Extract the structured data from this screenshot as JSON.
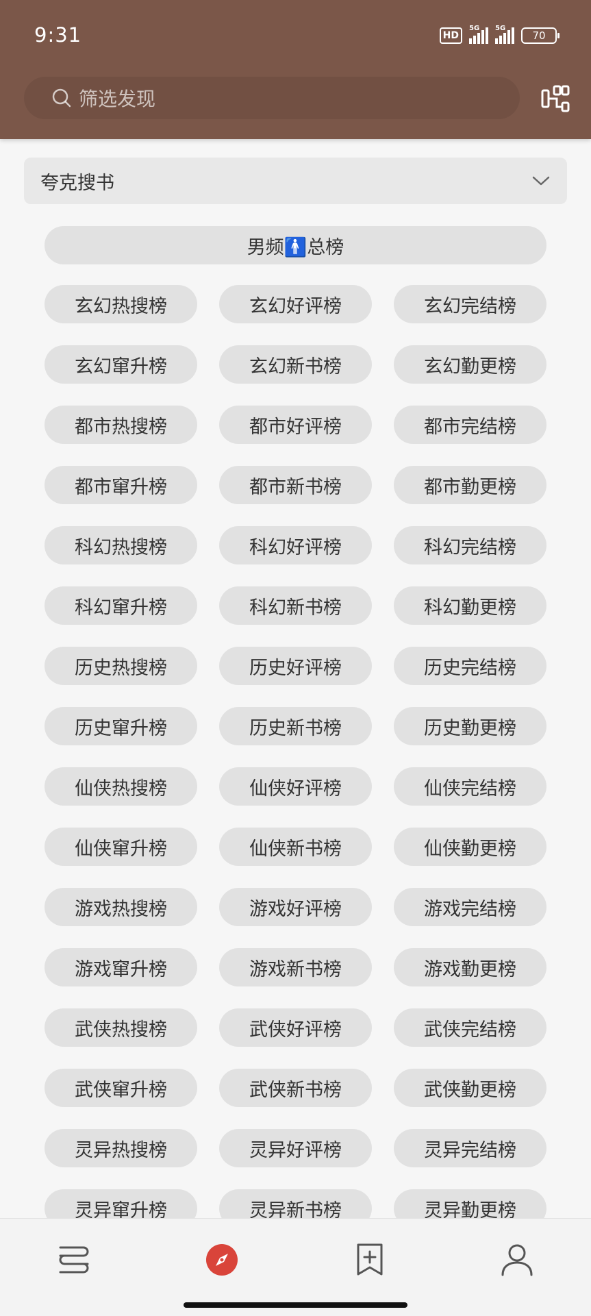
{
  "status_bar": {
    "time": "9:31",
    "hd_label": "HD",
    "sim1_label": "5G",
    "sim2_label": "5G",
    "battery": "70"
  },
  "header": {
    "search_placeholder": "筛选发现",
    "search_icon": "search-icon",
    "scan_icon": "scan-icon"
  },
  "source_selector": {
    "value": "夸克搜书"
  },
  "total_ranking": "男频🚹总榜",
  "rankings": [
    "玄幻热搜榜",
    "玄幻好评榜",
    "玄幻完结榜",
    "玄幻窜升榜",
    "玄幻新书榜",
    "玄幻勤更榜",
    "都市热搜榜",
    "都市好评榜",
    "都市完结榜",
    "都市窜升榜",
    "都市新书榜",
    "都市勤更榜",
    "科幻热搜榜",
    "科幻好评榜",
    "科幻完结榜",
    "科幻窜升榜",
    "科幻新书榜",
    "科幻勤更榜",
    "历史热搜榜",
    "历史好评榜",
    "历史完结榜",
    "历史窜升榜",
    "历史新书榜",
    "历史勤更榜",
    "仙侠热搜榜",
    "仙侠好评榜",
    "仙侠完结榜",
    "仙侠窜升榜",
    "仙侠新书榜",
    "仙侠勤更榜",
    "游戏热搜榜",
    "游戏好评榜",
    "游戏完结榜",
    "游戏窜升榜",
    "游戏新书榜",
    "游戏勤更榜",
    "武侠热搜榜",
    "武侠好评榜",
    "武侠完结榜",
    "武侠窜升榜",
    "武侠新书榜",
    "武侠勤更榜",
    "灵异热搜榜",
    "灵异好评榜",
    "灵异完结榜",
    "灵异窜升榜",
    "灵异新书榜",
    "灵异勤更榜"
  ],
  "bottom_nav": [
    {
      "icon": "bookshelf-icon",
      "active": false
    },
    {
      "icon": "compass-icon",
      "active": true
    },
    {
      "icon": "bookmark-add-icon",
      "active": false
    },
    {
      "icon": "person-icon",
      "active": false
    }
  ],
  "colors": {
    "header_bg": "#7b5749",
    "page_bg": "#f6f6f6",
    "chip_bg": "#e1e1e1",
    "accent": "#d9443a"
  }
}
